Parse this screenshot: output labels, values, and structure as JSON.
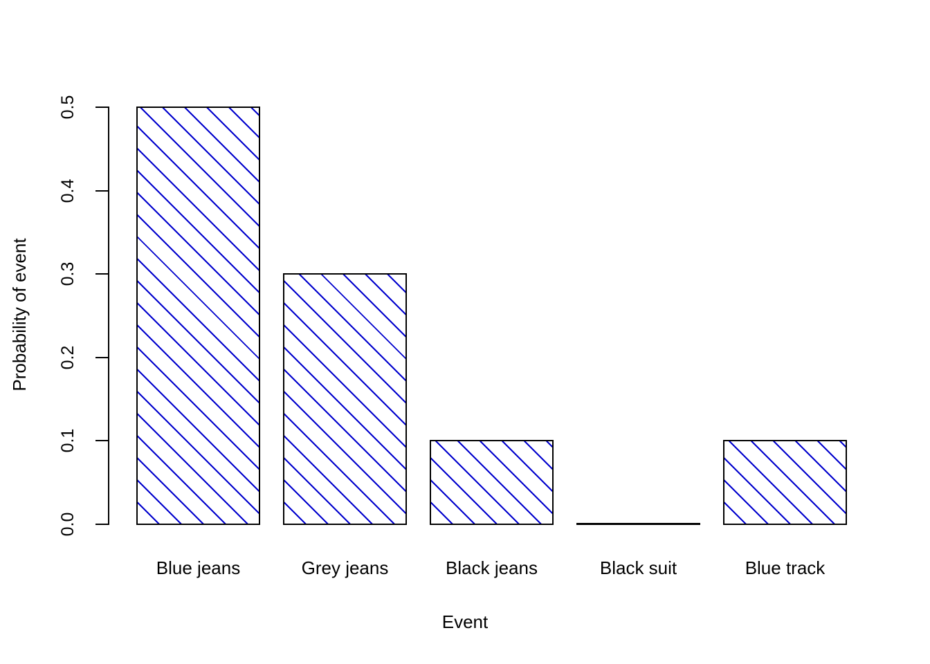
{
  "chart_data": {
    "type": "bar",
    "title": "",
    "xlabel": "Event",
    "ylabel": "Probability of event",
    "categories": [
      "Blue jeans",
      "Grey jeans",
      "Black jeans",
      "Black suit",
      "Blue track"
    ],
    "values": [
      0.5,
      0.3,
      0.1,
      0.0,
      0.1
    ],
    "ylim": [
      0.0,
      0.5
    ],
    "ytick_labels": [
      "0.0",
      "0.1",
      "0.2",
      "0.3",
      "0.4",
      "0.5"
    ],
    "ytick_values": [
      0.0,
      0.1,
      0.2,
      0.3,
      0.4,
      0.5
    ],
    "grid": false,
    "legend": "none",
    "bar_fill": "#ffffff",
    "bar_border_color": "#000000",
    "hatch_color": "#0000cd",
    "hatch_angle_deg": 45,
    "background": "#ffffff"
  },
  "axes": {
    "y_title": "Probability of event",
    "x_title": "Event",
    "y_labels": {
      "t0": "0.0",
      "t1": "0.1",
      "t2": "0.2",
      "t3": "0.3",
      "t4": "0.4",
      "t5": "0.5"
    }
  },
  "bars": {
    "b0": {
      "label": "Blue jeans",
      "value": "0.5"
    },
    "b1": {
      "label": "Grey jeans",
      "value": "0.3"
    },
    "b2": {
      "label": "Black jeans",
      "value": "0.1"
    },
    "b3": {
      "label": "Black suit",
      "value": "0.0"
    },
    "b4": {
      "label": "Blue track",
      "value": "0.1"
    }
  }
}
